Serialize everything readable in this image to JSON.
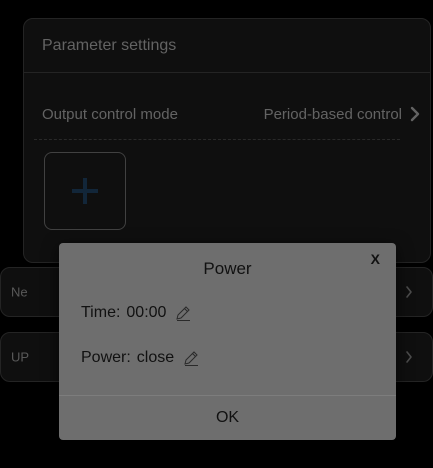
{
  "parameter_settings": {
    "title": "Parameter settings",
    "output_control_mode": {
      "label": "Output control mode",
      "value": "Period-based control"
    }
  },
  "rows": [
    {
      "label": "Ne"
    },
    {
      "label": "UP"
    }
  ],
  "dialog": {
    "title": "Power",
    "close_label": "X",
    "time": {
      "label": "Time:",
      "value": "00:00"
    },
    "power": {
      "label": "Power:",
      "value": "close"
    },
    "ok_label": "OK"
  },
  "colors": {
    "background": "#000000",
    "card": "#151515",
    "dialog": "#6e6e6e",
    "accent_plus": "#1a3550"
  },
  "icons": {
    "add": "plus-icon",
    "edit": "pencil-icon",
    "chevron": "chevron-right-icon"
  }
}
